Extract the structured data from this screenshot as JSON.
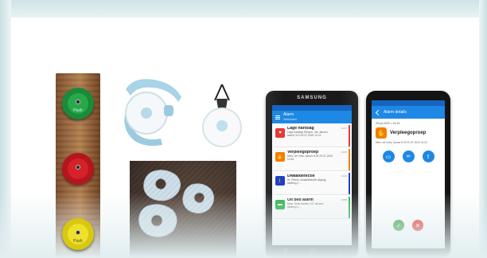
{
  "buttons": {
    "green_label": "Push",
    "red_label": "",
    "yellow_label": "Push"
  },
  "phone1": {
    "brand": "SAMSUNG",
    "app_title": "Alarm",
    "app_subtitle": "Verbonden",
    "alarms": [
      {
        "title": "Lage hartslag",
        "detail": "Lage hartslag 68 bpm. Jan Jansen, kamer 213 29-07-2020 14:21",
        "time": "14:21",
        "icon": "heart-icon",
        "color": "#e53935"
      },
      {
        "title": "Verpleegoproep",
        "detail": "Mevr. de Vries, kamer 8.09 29-07-2020 14:15",
        "time": "14:15",
        "icon": "nurse-call-icon",
        "color": "#f57c00"
      },
      {
        "title": "Dwaaldetectie",
        "detail": "Hr. Peters, dwaaldetectie uitgang, afdeling 2 ...",
        "time": "14:12",
        "icon": "wander-icon",
        "color": "#1e40c8"
      },
      {
        "title": "Uit bed alarm",
        "detail": "Mevr. Smit, kamer 1.07 uit bed, afdeling 1 ...",
        "time": "13:58",
        "icon": "bed-icon",
        "color": "#2bb34a"
      }
    ],
    "nav": [
      "|||",
      "◯",
      "‹"
    ]
  },
  "phone2": {
    "app_title": "Alarm details",
    "time_line": "29-jul-2020 • 14:15",
    "title": "Verpleegoproep",
    "detail": "Mevr. de Vries, Kamer 8.09 29-07-2020 14:15",
    "actions": [
      "video",
      "link",
      "share"
    ],
    "accept_color": "#43a047",
    "reject_color": "#e53935"
  }
}
